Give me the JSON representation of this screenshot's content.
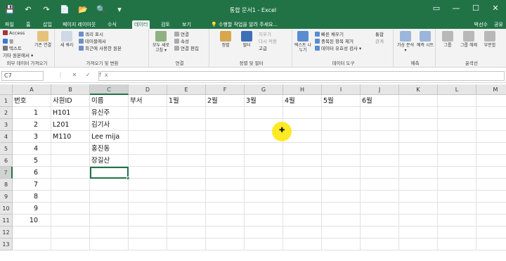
{
  "window": {
    "title": "통합 문서1 - Excel",
    "qat": [
      "💾",
      "↶",
      "↷",
      "📄",
      "📂",
      "🔍",
      "▾"
    ],
    "controls": [
      "▭",
      "—",
      "☐",
      "✕"
    ]
  },
  "tabs": [
    {
      "label": "파일",
      "active": false
    },
    {
      "label": "홈",
      "active": false
    },
    {
      "label": "삽입",
      "active": false
    },
    {
      "label": "페이지 레이아웃",
      "active": false
    },
    {
      "label": "수식",
      "active": false
    },
    {
      "label": "데이터",
      "active": true
    },
    {
      "label": "검토",
      "active": false
    },
    {
      "label": "보기",
      "active": false
    }
  ],
  "tell_me": "💡 수행할 작업을 알려 주세요...",
  "user": "박선수",
  "share": "공유",
  "ribbon": {
    "groups": [
      {
        "label": "외부 데이터 가져오기",
        "items": [
          "Access",
          "웹",
          "텍스트",
          "기타 원본에서 ▾"
        ],
        "buttons": [
          "기존 연결"
        ]
      },
      {
        "label": "가져오기 및 변환",
        "items": [
          "쿼리 표시",
          "테이블에서",
          "최근에 사용한 원본"
        ],
        "buttons": [
          "새 쿼리"
        ]
      },
      {
        "label": "연결",
        "items": [
          "연결",
          "속성",
          "연결 편집"
        ],
        "buttons": [
          "모두 새로 고침 ▾"
        ]
      },
      {
        "label": "정렬 및 필터",
        "items": [
          "지우기",
          "다시 적용",
          "고급"
        ],
        "buttons": [
          "정렬",
          "필터"
        ]
      },
      {
        "label": "데이터 도구",
        "items": [
          "빠른 채우기",
          "중복된 항목 제거",
          "데이터 유효성 검사 ▾",
          "통합",
          "관계"
        ],
        "buttons": [
          "텍스트 나누기"
        ]
      },
      {
        "label": "예측",
        "items": [],
        "buttons": [
          "가상 분석 ▾",
          "예측 시트"
        ]
      },
      {
        "label": "윤곽선",
        "items": [],
        "buttons": [
          "그룹",
          "그룹 해제",
          "부분합"
        ]
      }
    ]
  },
  "name_box": "C7",
  "fx_buttons": "⋮ ✕ ✓ fx",
  "columns": [
    "A",
    "B",
    "C",
    "D",
    "E",
    "F",
    "G",
    "H",
    "I",
    "J",
    "K",
    "L",
    "M"
  ],
  "selected_column": "C",
  "rows": [
    "1",
    "2",
    "3",
    "4",
    "5",
    "6",
    "7",
    "8",
    "9",
    "10",
    "11",
    "12",
    "13"
  ],
  "selected_row": "7",
  "cells": {
    "A1": "번호",
    "B1": "사원ID",
    "C1": "이름",
    "D1": "부서",
    "E1": "1월",
    "F1": "2월",
    "G1": "3월",
    "H1": "4월",
    "I1": "5월",
    "J1": "6월",
    "A2": "1",
    "A3": "2",
    "A4": "3",
    "A5": "4",
    "A6": "5",
    "A7": "6",
    "A8": "7",
    "A9": "8",
    "A10": "9",
    "A11": "10",
    "B2": "H101",
    "B3": "L201",
    "B4": "M110",
    "C2": "유신주",
    "C3": "김기사",
    "C4": "Lee mija",
    "C5": "홍진동",
    "C6": "장길산"
  },
  "active_cell": "C7"
}
